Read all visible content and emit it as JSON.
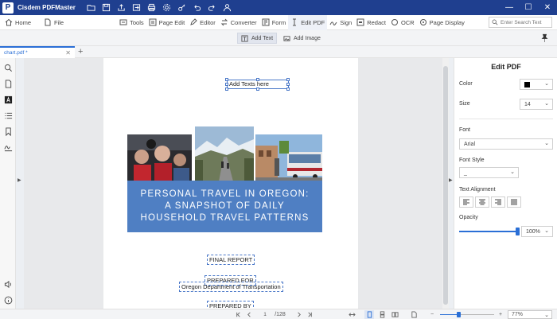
{
  "app": {
    "name": "Cisdem PDFMaster",
    "logo_letter": "P"
  },
  "menu": {
    "home": "Home",
    "file": "File",
    "tools": "Tools",
    "page_edit": "Page Edit",
    "editor": "Editor",
    "converter": "Converter",
    "form": "Form",
    "edit_pdf": "Edit PDF",
    "sign": "Sign",
    "redact": "Redact",
    "ocr": "OCR",
    "page_display": "Page Display"
  },
  "search": {
    "placeholder": "Enter Search Text"
  },
  "subtoolbar": {
    "add_text": "Add Text",
    "add_image": "Add Image"
  },
  "tab": {
    "title": "chart.pdf *"
  },
  "page": {
    "add_texts_placeholder": "Add Texts here",
    "banner_lines": [
      "PERSONAL TRAVEL IN OREGON:",
      "A SNAPSHOT OF DAILY",
      "HOUSEHOLD TRAVEL PATTERNS"
    ],
    "final_report": "FINAL REPORT",
    "prepared_for": "PREPARED FOR",
    "odot": "Oregon Department of Transportation",
    "prepared_by": "PREPARED BY"
  },
  "panel": {
    "title": "Edit PDF",
    "color_label": "Color",
    "color_value": "#000000",
    "size_label": "Size",
    "size_value": "14",
    "font_label": "Font",
    "font_value": "Arial",
    "font_style_label": "Font Style",
    "font_style_value": "_",
    "alignment_label": "Text Alignment",
    "opacity_label": "Opacity",
    "opacity_value": "100%",
    "opacity_level": 1.0
  },
  "status": {
    "current_page": "1",
    "total_pages": "/128",
    "zoom": "77%",
    "zoom_level": 0.34
  },
  "icons": {
    "save": "save-icon",
    "folder": "folder-icon",
    "share": "share-icon",
    "print": "print-icon",
    "settings": "settings-icon",
    "search": "search-icon",
    "undo": "undo-icon",
    "redo": "redo-icon",
    "user": "user-icon"
  }
}
